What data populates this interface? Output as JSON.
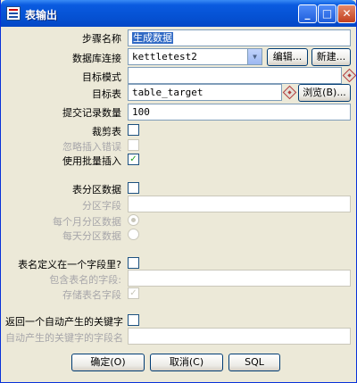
{
  "window": {
    "title": "表输出"
  },
  "titlebar_buttons": {
    "minimize": "_",
    "maximize": "□",
    "close": "✕"
  },
  "form": {
    "step_name": {
      "label": "步骤名称",
      "value": "生成数据"
    },
    "connection": {
      "label": "数据库连接",
      "value": "kettletest2",
      "edit_button": "编辑...",
      "new_button": "新建..."
    },
    "target_schema": {
      "label": "目标模式",
      "value": ""
    },
    "target_table": {
      "label": "目标表",
      "value": "table_target",
      "browse_button": "浏览(B)..."
    },
    "commit_size": {
      "label": "提交记录数量",
      "value": "100"
    },
    "truncate": {
      "label": "裁剪表",
      "checked": false
    },
    "ignore_errors": {
      "label": "忽略插入错误",
      "checked": false
    },
    "batch_insert": {
      "label": "使用批量插入",
      "checked": true
    },
    "partition": {
      "label": "表分区数据",
      "checked": false
    },
    "partition_field": {
      "label": "分区字段",
      "value": ""
    },
    "partition_monthly": {
      "label": "每个月分区数据",
      "selected": true
    },
    "partition_daily": {
      "label": "每天分区数据",
      "selected": false
    },
    "table_in_field": {
      "label": "表名定义在一个字段里?",
      "checked": false
    },
    "table_name_field": {
      "label": "包含表名的字段:",
      "value": ""
    },
    "store_table_name": {
      "label": "存储表名字段",
      "checked": true
    },
    "return_key": {
      "label": "返回一个自动产生的关键字",
      "checked": false
    },
    "key_field_name": {
      "label": "自动产生的关键字的字段名",
      "value": ""
    }
  },
  "buttons": {
    "ok": "确定(O)",
    "cancel": "取消(C)",
    "sql": "SQL"
  },
  "icons": {
    "checkmark": "✓",
    "dropdown": "▼"
  }
}
